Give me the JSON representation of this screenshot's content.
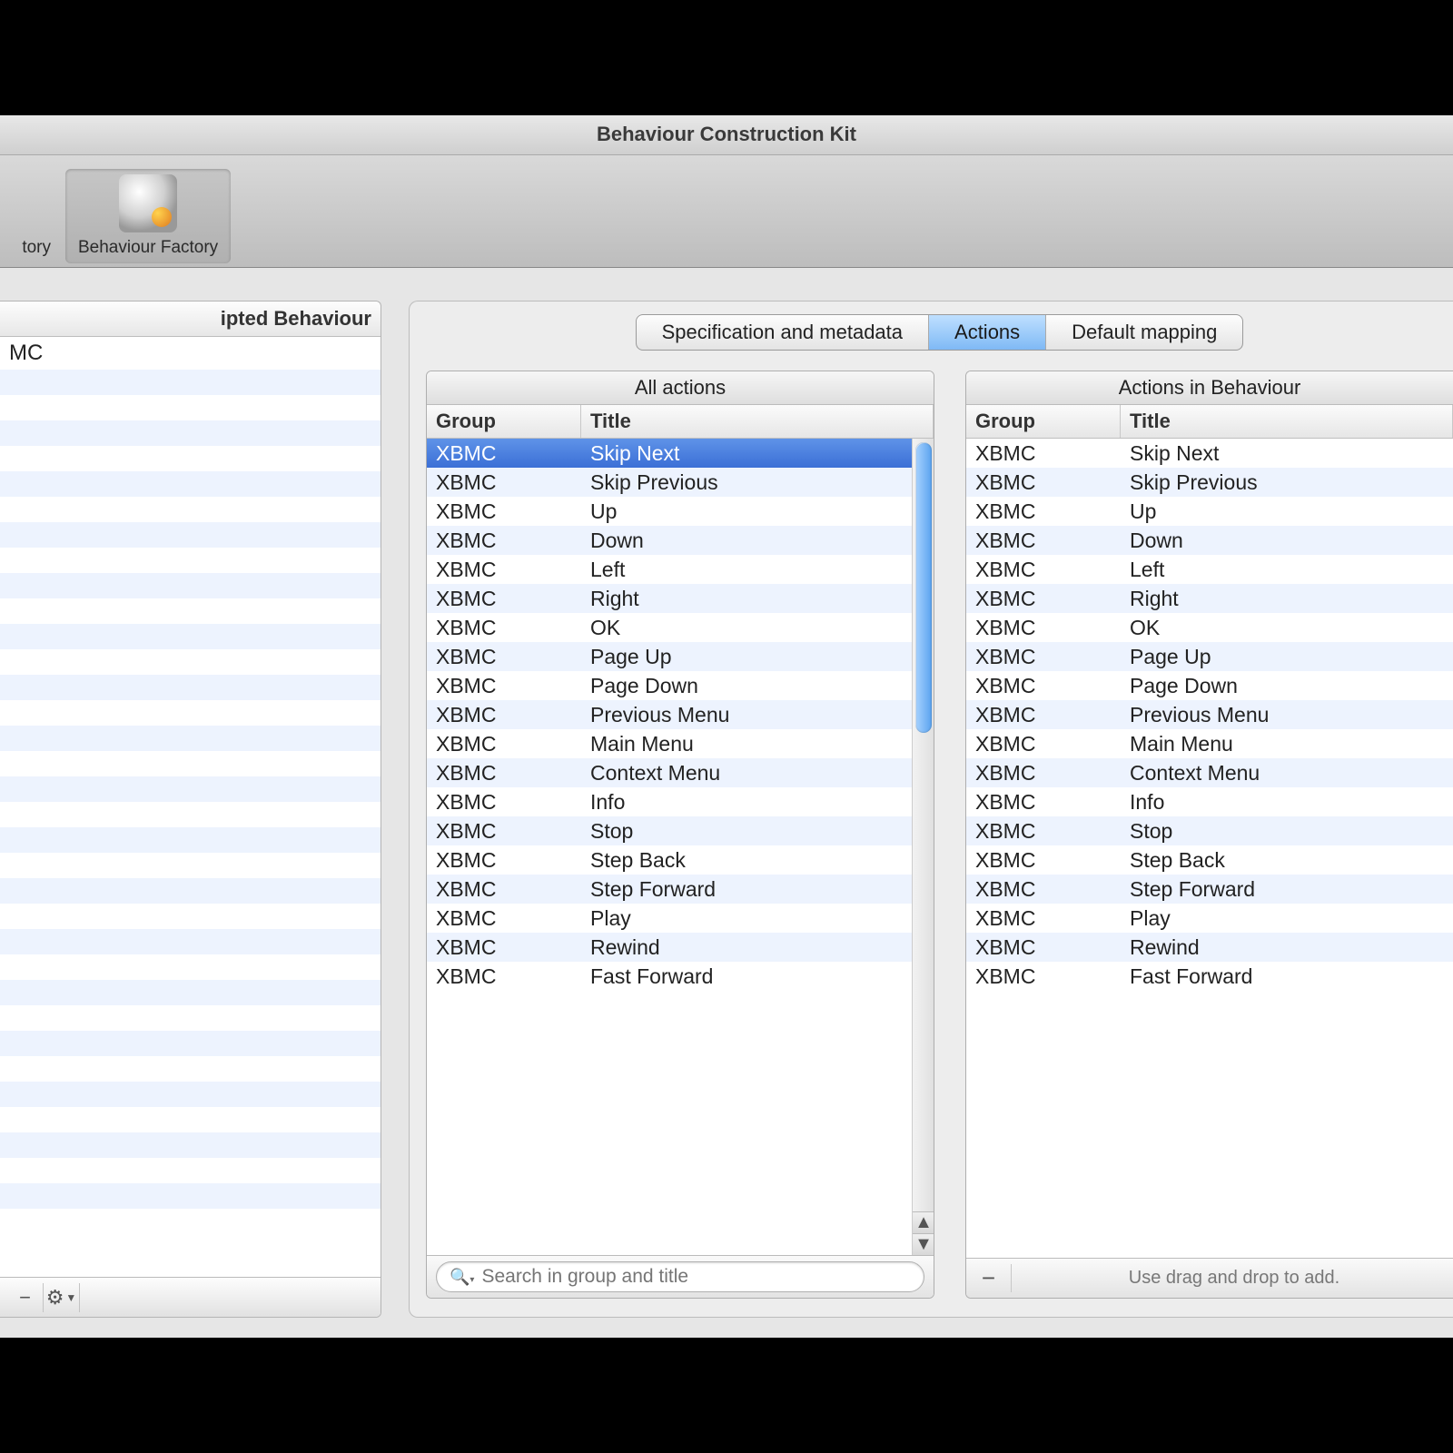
{
  "window_title": "Behaviour Construction Kit",
  "toolbar": {
    "item_left_partial": "tory",
    "item_selected": "Behaviour Factory"
  },
  "sidebar": {
    "header_partial": "ipted Behaviour",
    "item_partial": "MC",
    "footer": {
      "remove": "−",
      "gear": "✻"
    }
  },
  "segmented": {
    "spec": "Specification and metadata",
    "actions": "Actions",
    "mapping": "Default mapping"
  },
  "all_actions": {
    "title": "All actions",
    "columns": {
      "group": "Group",
      "title": "Title"
    },
    "search_placeholder": "Search in group and title",
    "rows": [
      {
        "group": "XBMC",
        "title": "Skip Next",
        "selected": true
      },
      {
        "group": "XBMC",
        "title": "Skip Previous"
      },
      {
        "group": "XBMC",
        "title": "Up"
      },
      {
        "group": "XBMC",
        "title": "Down"
      },
      {
        "group": "XBMC",
        "title": "Left"
      },
      {
        "group": "XBMC",
        "title": "Right"
      },
      {
        "group": "XBMC",
        "title": "OK"
      },
      {
        "group": "XBMC",
        "title": "Page Up"
      },
      {
        "group": "XBMC",
        "title": "Page Down"
      },
      {
        "group": "XBMC",
        "title": "Previous Menu"
      },
      {
        "group": "XBMC",
        "title": "Main Menu"
      },
      {
        "group": "XBMC",
        "title": "Context Menu"
      },
      {
        "group": "XBMC",
        "title": "Info"
      },
      {
        "group": "XBMC",
        "title": "Stop"
      },
      {
        "group": "XBMC",
        "title": "Step Back"
      },
      {
        "group": "XBMC",
        "title": "Step Forward"
      },
      {
        "group": "XBMC",
        "title": "Play"
      },
      {
        "group": "XBMC",
        "title": "Rewind"
      },
      {
        "group": "XBMC",
        "title": "Fast Forward"
      }
    ]
  },
  "in_behaviour": {
    "title": "Actions in Behaviour",
    "columns": {
      "group": "Group",
      "title": "Title"
    },
    "remove": "−",
    "hint": "Use drag and drop to add.",
    "rows": [
      {
        "group": "XBMC",
        "title": "Skip Next"
      },
      {
        "group": "XBMC",
        "title": "Skip Previous"
      },
      {
        "group": "XBMC",
        "title": "Up"
      },
      {
        "group": "XBMC",
        "title": "Down"
      },
      {
        "group": "XBMC",
        "title": "Left"
      },
      {
        "group": "XBMC",
        "title": "Right"
      },
      {
        "group": "XBMC",
        "title": "OK"
      },
      {
        "group": "XBMC",
        "title": "Page Up"
      },
      {
        "group": "XBMC",
        "title": "Page Down"
      },
      {
        "group": "XBMC",
        "title": "Previous Menu"
      },
      {
        "group": "XBMC",
        "title": "Main Menu"
      },
      {
        "group": "XBMC",
        "title": "Context Menu"
      },
      {
        "group": "XBMC",
        "title": "Info"
      },
      {
        "group": "XBMC",
        "title": "Stop"
      },
      {
        "group": "XBMC",
        "title": "Step Back"
      },
      {
        "group": "XBMC",
        "title": "Step Forward"
      },
      {
        "group": "XBMC",
        "title": "Play"
      },
      {
        "group": "XBMC",
        "title": "Rewind"
      },
      {
        "group": "XBMC",
        "title": "Fast Forward"
      }
    ]
  }
}
